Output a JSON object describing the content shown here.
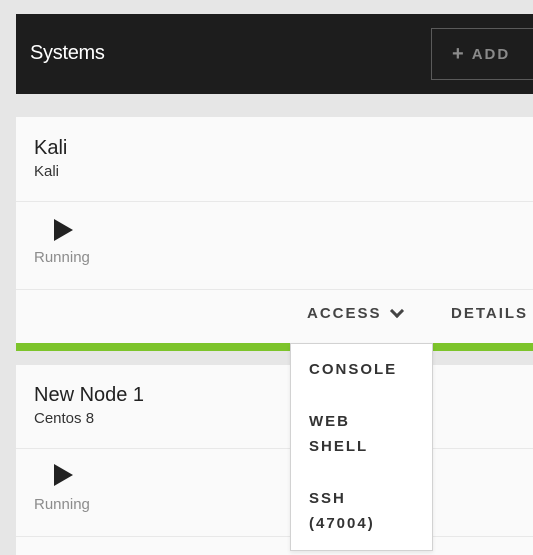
{
  "header": {
    "title": "Systems",
    "add_label": "ADD",
    "add_icon": "+"
  },
  "cards": [
    {
      "name": "Kali",
      "os": "Kali",
      "status": "Running"
    },
    {
      "name": "New Node 1",
      "os": "Centos 8",
      "status": "Running"
    }
  ],
  "actions": {
    "access_label": "ACCESS",
    "details_label": "DETAILS"
  },
  "access_menu": {
    "console": "CONSOLE",
    "web_shell_line1": "WEB",
    "web_shell_line2": "SHELL",
    "ssh_line1": "SSH",
    "ssh_line2": "(47004)"
  },
  "colors": {
    "header_bg": "#1d1d1d",
    "accent": "#7dc42b"
  }
}
